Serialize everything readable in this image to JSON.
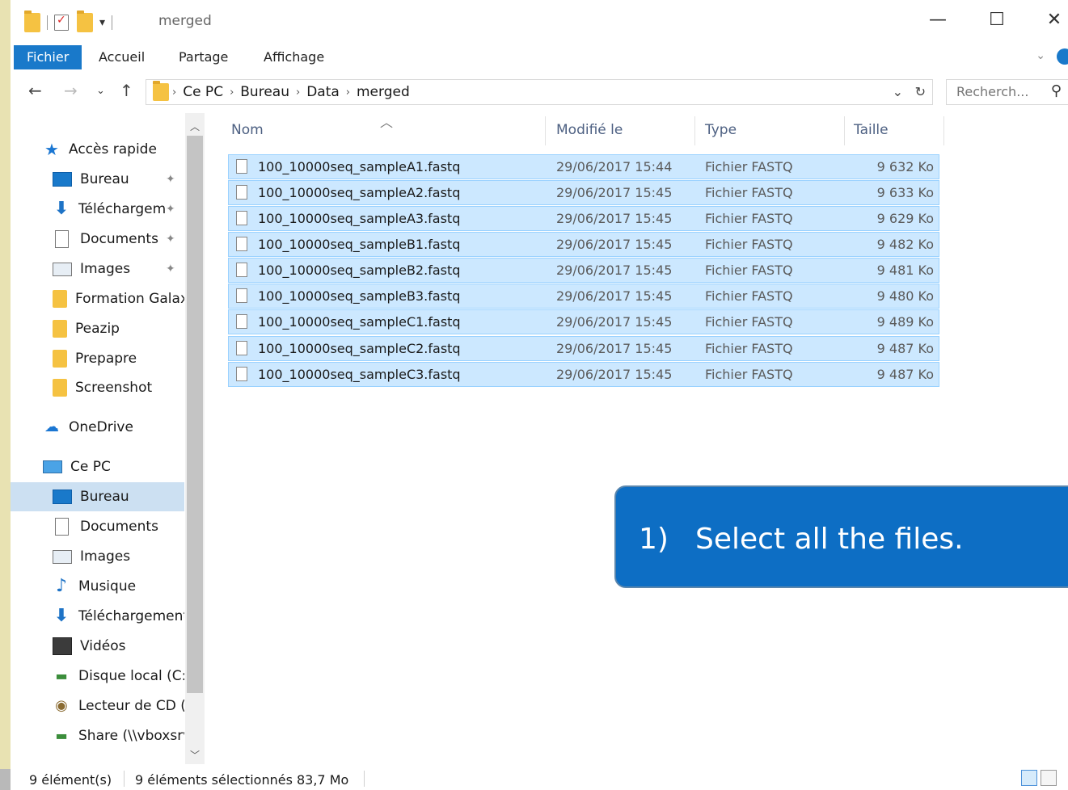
{
  "window": {
    "title": "merged",
    "controls": [
      "—",
      "☐",
      "✕"
    ]
  },
  "ribbon": {
    "tabs": [
      "Fichier",
      "Accueil",
      "Partage",
      "Affichage"
    ]
  },
  "address": {
    "crumbs": [
      "Ce PC",
      "Bureau",
      "Data",
      "merged"
    ],
    "search_placeholder": "Recherch..."
  },
  "navpane": {
    "items": [
      {
        "label": "Accès rapide",
        "icon": "star-icon"
      },
      {
        "label": "Bureau",
        "icon": "desktop-icon",
        "pinned": true
      },
      {
        "label": "Téléchargem",
        "icon": "download-icon",
        "pinned": true
      },
      {
        "label": "Documents",
        "icon": "document-icon",
        "pinned": true
      },
      {
        "label": "Images",
        "icon": "images-icon",
        "pinned": true
      },
      {
        "label": "Formation Galax",
        "icon": "folder-icon"
      },
      {
        "label": "Peazip",
        "icon": "folder-icon"
      },
      {
        "label": "Prepapre",
        "icon": "folder-icon"
      },
      {
        "label": "Screenshot",
        "icon": "folder-icon"
      },
      {
        "label": "OneDrive",
        "icon": "cloud-icon"
      },
      {
        "label": "Ce PC",
        "icon": "computer-icon"
      },
      {
        "label": "Bureau",
        "icon": "desktop-icon",
        "selected": true
      },
      {
        "label": "Documents",
        "icon": "document-icon"
      },
      {
        "label": "Images",
        "icon": "images-icon"
      },
      {
        "label": "Musique",
        "icon": "music-icon"
      },
      {
        "label": "Téléchargement",
        "icon": "download-icon"
      },
      {
        "label": "Vidéos",
        "icon": "video-icon"
      },
      {
        "label": "Disque local (C:)",
        "icon": "drive-icon"
      },
      {
        "label": "Lecteur de CD (D",
        "icon": "cd-drive-icon"
      },
      {
        "label": "Share (\\\\vboxsrv",
        "icon": "network-drive-icon"
      }
    ]
  },
  "filelist": {
    "columns": [
      "Nom",
      "Modifié le",
      "Type",
      "Taille"
    ],
    "rows": [
      {
        "name": "100_10000seq_sampleA1.fastq",
        "date": "29/06/2017 15:44",
        "type": "Fichier FASTQ",
        "size": "9 632 Ko"
      },
      {
        "name": "100_10000seq_sampleA2.fastq",
        "date": "29/06/2017 15:45",
        "type": "Fichier FASTQ",
        "size": "9 633 Ko"
      },
      {
        "name": "100_10000seq_sampleA3.fastq",
        "date": "29/06/2017 15:45",
        "type": "Fichier FASTQ",
        "size": "9 629 Ko"
      },
      {
        "name": "100_10000seq_sampleB1.fastq",
        "date": "29/06/2017 15:45",
        "type": "Fichier FASTQ",
        "size": "9 482 Ko"
      },
      {
        "name": "100_10000seq_sampleB2.fastq",
        "date": "29/06/2017 15:45",
        "type": "Fichier FASTQ",
        "size": "9 481 Ko"
      },
      {
        "name": "100_10000seq_sampleB3.fastq",
        "date": "29/06/2017 15:45",
        "type": "Fichier FASTQ",
        "size": "9 480 Ko"
      },
      {
        "name": "100_10000seq_sampleC1.fastq",
        "date": "29/06/2017 15:45",
        "type": "Fichier FASTQ",
        "size": "9 489 Ko"
      },
      {
        "name": "100_10000seq_sampleC2.fastq",
        "date": "29/06/2017 15:45",
        "type": "Fichier FASTQ",
        "size": "9 487 Ko"
      },
      {
        "name": "100_10000seq_sampleC3.fastq",
        "date": "29/06/2017 15:45",
        "type": "Fichier FASTQ",
        "size": "9 487 Ko"
      }
    ]
  },
  "callout": {
    "number": "1)",
    "text": "Select all the files."
  },
  "status": {
    "count": "9 élément(s)",
    "selection": "9 éléments sélectionnés  83,7 Mo"
  },
  "colors": {
    "accent": "#1979ca",
    "selection_bg": "#cce8ff",
    "callout_bg": "#0d6ec4"
  }
}
